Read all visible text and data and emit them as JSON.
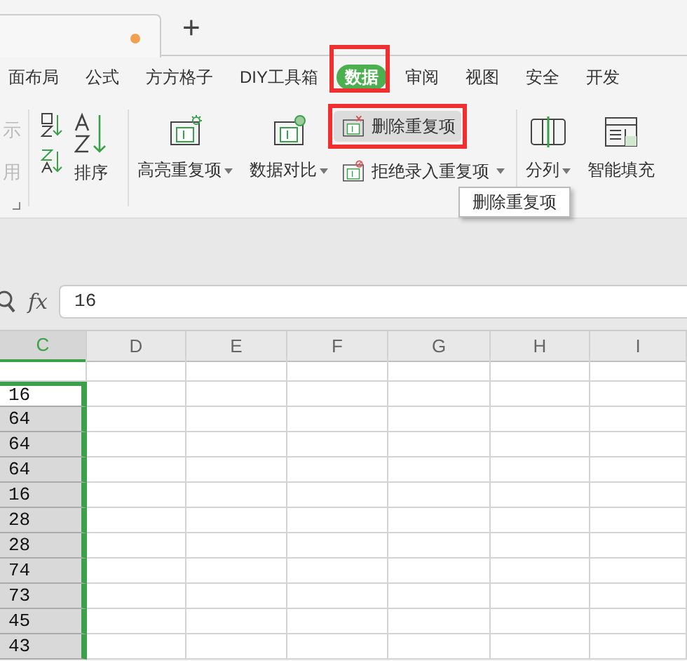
{
  "tab_bar": {
    "tab": {
      "unsaved": true
    },
    "new_tab": "+"
  },
  "menu": [
    {
      "label": "面布局",
      "selected": false,
      "framed": false
    },
    {
      "label": "公式",
      "selected": false,
      "framed": false
    },
    {
      "label": "方方格子",
      "selected": false,
      "framed": false
    },
    {
      "label": "DIY工具箱",
      "selected": false,
      "framed": false
    },
    {
      "label": "数据",
      "selected": true,
      "framed": true
    },
    {
      "label": "审阅",
      "selected": false,
      "framed": false
    },
    {
      "label": "视图",
      "selected": false,
      "framed": false
    },
    {
      "label": "安全",
      "selected": false,
      "framed": false
    },
    {
      "label": "开发",
      "selected": false,
      "framed": false
    }
  ],
  "ribbon": {
    "cut_labels": [
      {
        "label": "示",
        "disabled": true
      },
      {
        "label": "用",
        "disabled": true
      }
    ],
    "sort": {
      "label": "排序"
    },
    "buttons": [
      {
        "kind": "highlight",
        "label": "高亮重复项",
        "dropdown": true
      },
      {
        "kind": "compare",
        "label": "数据对比",
        "dropdown": true
      }
    ],
    "stack": [
      {
        "kind": "remove",
        "label": "删除重复项",
        "dropdown": false,
        "hovered": true,
        "framed": true
      },
      {
        "kind": "reject",
        "label": "拒绝录入重复项",
        "dropdown": true,
        "hovered": false,
        "framed": false
      }
    ],
    "tools": [
      {
        "kind": "split",
        "label": "分列",
        "dropdown": true
      },
      {
        "kind": "fill",
        "label": "智能填充",
        "dropdown": false
      }
    ],
    "tooltip": "删除重复项"
  },
  "formula_bar": {
    "function_label": "fx",
    "value": "16"
  },
  "sheet": {
    "columns": [
      {
        "label": "C",
        "selected": true
      },
      {
        "label": "D",
        "selected": false
      },
      {
        "label": "E",
        "selected": false
      },
      {
        "label": "F",
        "selected": false
      },
      {
        "label": "G",
        "selected": false
      },
      {
        "label": "H",
        "selected": false
      },
      {
        "label": "I",
        "selected": false
      }
    ],
    "rows": [
      {
        "value": "",
        "selected": false,
        "active": false
      },
      {
        "value": "16",
        "selected": true,
        "active": true
      },
      {
        "value": "64",
        "selected": true,
        "active": false
      },
      {
        "value": "64",
        "selected": true,
        "active": false
      },
      {
        "value": "64",
        "selected": true,
        "active": false
      },
      {
        "value": "16",
        "selected": true,
        "active": false
      },
      {
        "value": "28",
        "selected": true,
        "active": false
      },
      {
        "value": "28",
        "selected": true,
        "active": false
      },
      {
        "value": "74",
        "selected": true,
        "active": false
      },
      {
        "value": "73",
        "selected": true,
        "active": false
      },
      {
        "value": "45",
        "selected": true,
        "active": false
      },
      {
        "value": "43",
        "selected": true,
        "active": false
      }
    ]
  }
}
